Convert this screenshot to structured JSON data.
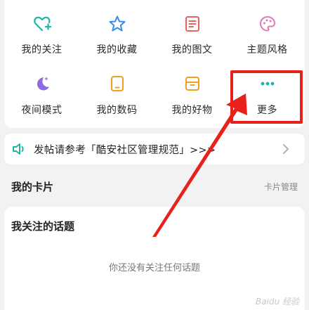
{
  "grid": {
    "items": [
      {
        "label": "我的关注",
        "icon": "heart-plus-icon"
      },
      {
        "label": "我的收藏",
        "icon": "star-icon"
      },
      {
        "label": "我的图文",
        "icon": "document-icon"
      },
      {
        "label": "主题风格",
        "icon": "palette-icon"
      },
      {
        "label": "夜间模式",
        "icon": "moon-icon"
      },
      {
        "label": "我的数码",
        "icon": "device-icon"
      },
      {
        "label": "我的好物",
        "icon": "box-icon"
      },
      {
        "label": "更多",
        "icon": "more-dots-icon"
      }
    ]
  },
  "notice": {
    "text": "发帖请参考「酷安社区管理规范」>>>"
  },
  "cards_section": {
    "title": "我的卡片",
    "action": "卡片管理"
  },
  "topics": {
    "title": "我关注的话题",
    "empty_text": "你还没有关注任何话题"
  },
  "watermark": {
    "text": "Baidu 经验"
  },
  "colors": {
    "accent_red": "#e8211b",
    "teal": "#1fb5a8",
    "blue": "#3a8ee6",
    "coral": "#e8645a",
    "pink": "#e07ab8",
    "purple": "#8f6ae0",
    "orange": "#f0a020"
  }
}
